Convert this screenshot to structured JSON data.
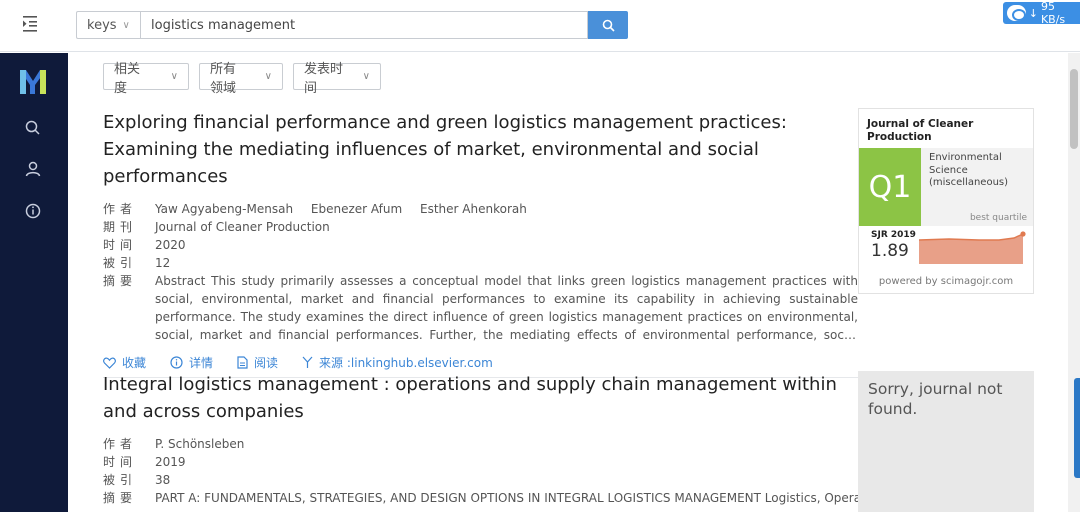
{
  "search": {
    "type_label": "keys",
    "query": "logistics management"
  },
  "network_badge": {
    "speed": "95 KB/s"
  },
  "filters": [
    {
      "label": "相关度"
    },
    {
      "label": "所有领域"
    },
    {
      "label": "发表时间"
    }
  ],
  "meta_labels": {
    "author": "作者",
    "journal": "期刊",
    "year": "时间",
    "citations": "被引",
    "abstract": "摘要"
  },
  "actions": {
    "favorite": "收藏",
    "details": "详情",
    "read": "阅读",
    "source_prefix": "来源 : "
  },
  "results": [
    {
      "title": "Exploring financial performance and green logistics management practices: Examining the mediating influences of market, environmental and social performances",
      "authors": [
        "Yaw Agyabeng-Mensah",
        "Ebenezer Afum",
        "Esther Ahenkorah"
      ],
      "journal": "Journal of Cleaner Production",
      "year": "2020",
      "citations": "12",
      "abstract": "Abstract This study primarily assesses a conceptual model that links green logistics management practices with social, environmental, market and financial performances to examine its capability in achieving sustainable performance. The study examines the direct influence of green logistics management practices on environmental, social, market and financial performances. Further, the mediating effects of environmental performance, social performance and market performance on the relationship between green logistics management practices and financial performance are examined.",
      "source": "linkinghub.elsevier.com",
      "journal_card": {
        "journal_name": "Journal of Cleaner Production",
        "quartile": "Q1",
        "category": "Environmental Science (miscellaneous)",
        "best_label": "best quartile",
        "sjr_label": "SJR 2019",
        "sjr_value": "1.89",
        "powered": "powered by scimagojr.com",
        "colors": {
          "quartile": "#8cc445",
          "spark": "#e8a088",
          "spark_line": "#e07a50"
        }
      }
    },
    {
      "title": "Integral logistics management : operations and supply chain management within and across companies",
      "authors": [
        "P. Schönsleben"
      ],
      "year": "2019",
      "citations": "38",
      "abstract": "PART A: FUNDAMENTALS, STRATEGIES, AND DESIGN OPTIONS IN INTEGRAL LOGISTICS MANAGEMENT Logistics, Operations,",
      "not_found_card": "Sorry, journal not found."
    }
  ]
}
